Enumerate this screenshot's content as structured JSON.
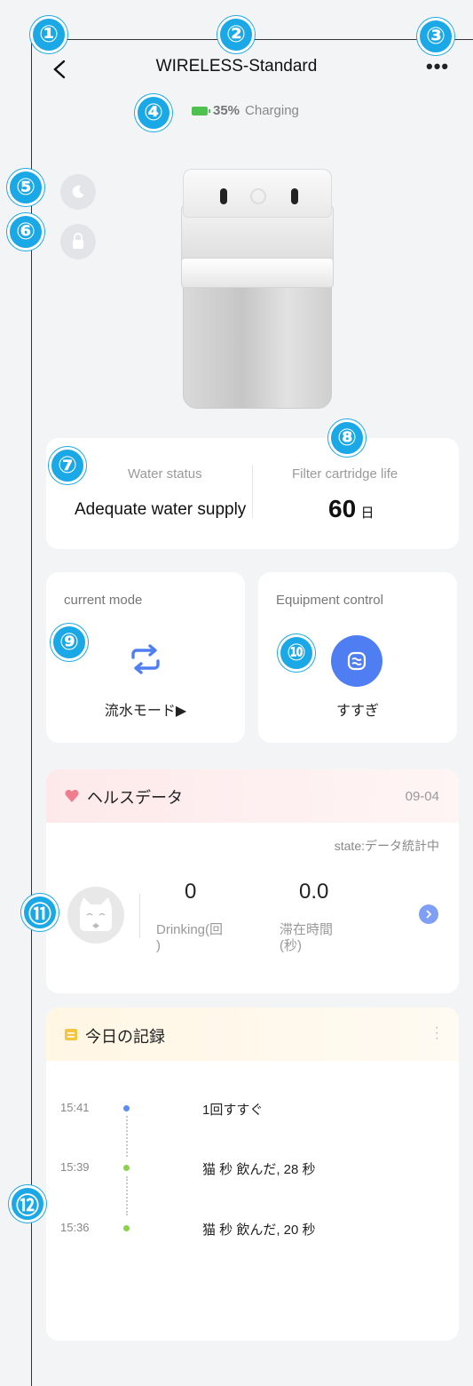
{
  "header": {
    "title": "WIRELESS-Standard",
    "more_label": "•••"
  },
  "battery": {
    "percent": "35%",
    "state": "Charging"
  },
  "status": {
    "water_label": "Water status",
    "water_value": "Adequate water supply",
    "filter_label": "Filter cartridge life",
    "filter_value": "60",
    "filter_unit": "日"
  },
  "mode": {
    "title": "current mode",
    "value": "流水モード▶"
  },
  "control": {
    "title": "Equipment control",
    "action": "すすぎ"
  },
  "health": {
    "title": "ヘルスデータ",
    "date": "09-04",
    "state": "state:データ統計中",
    "drinking_value": "0",
    "drinking_label": "Drinking(回\n)",
    "stay_value": "0.0",
    "stay_label": "滞在時間\n(秒)"
  },
  "records": {
    "title": "今日の記録",
    "items": [
      {
        "time": "15:41",
        "text": "1回すすぐ",
        "color": "#5b8ef0"
      },
      {
        "time": "15:39",
        "text": "猫 秒 飲んだ, 28 秒",
        "color": "#8bd24a"
      },
      {
        "time": "15:36",
        "text": "猫 秒 飲んだ, 20 秒",
        "color": "#8bd24a"
      }
    ]
  },
  "annotations": [
    "①",
    "②",
    "③",
    "④",
    "⑤",
    "⑥",
    "⑦",
    "⑧",
    "⑨",
    "⑩",
    "⑪",
    "⑫"
  ],
  "colors": {
    "marker": "#1ba8e6",
    "accent_blue": "#4f7ef2",
    "battery_green": "#4ec14f"
  }
}
